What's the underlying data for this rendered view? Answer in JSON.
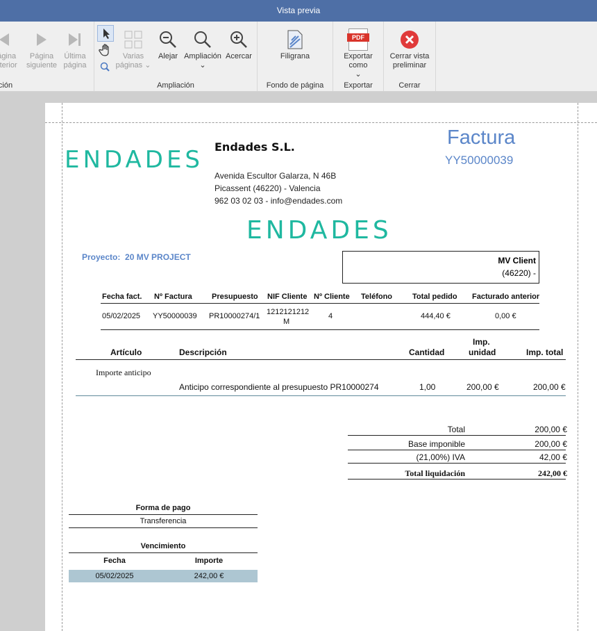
{
  "window": {
    "title": "Vista previa"
  },
  "ribbon": {
    "nav": {
      "prev_label": "Página anterior",
      "next_label": "Página siguiente",
      "last_label": "Última página",
      "group_label": "Navegación"
    },
    "zoom": {
      "multi_label": "Varias páginas",
      "away_label": "Alejar",
      "zoom_label": "Ampliación",
      "closer_label": "Acercar",
      "group_label": "Ampliación"
    },
    "background": {
      "watermark_label": "Filigrana",
      "group_label": "Fondo de página"
    },
    "export": {
      "export_label": "Exportar como",
      "pdf_text": "PDF",
      "group_label": "Exportar"
    },
    "close": {
      "close_label": "Cerrar vista preliminar",
      "group_label": "Cerrar"
    }
  },
  "invoice": {
    "logo_text": "ENDADES",
    "company": "Endades S.L.",
    "address1": "Avenida Escultor Galarza, N 46B",
    "address2": "Picassent (46220) - Valencia",
    "address3": "962 03 02 03 - info@endades.com",
    "doc_title": "Factura",
    "doc_number": "YY50000039",
    "project_label": "Proyecto:",
    "project_value": "20 MV PROJECT",
    "client_name": "MV Client",
    "client_address": "(46220) -",
    "header_table": {
      "columns": [
        "Fecha fact.",
        "Nº Factura",
        "Presupuesto",
        "NIF Cliente",
        "Nº Cliente",
        "Teléfono",
        "Total pedido",
        "Facturado anterior"
      ],
      "row": [
        "05/02/2025",
        "YY50000039",
        "PR10000274/1",
        "1212121212",
        "M",
        "4",
        "",
        "444,40 €",
        "0,00 €"
      ]
    },
    "lines_table": {
      "columns": [
        "Artículo",
        "Descripción",
        "Cantidad",
        "Imp.",
        "unidad",
        "Imp. total"
      ],
      "article": "Importe anticipo",
      "description": "Anticipo correspondiente al presupuesto PR10000274",
      "quantity": "1,00",
      "unit_price": "200,00 €",
      "total": "200,00 €"
    },
    "totals": {
      "total_label": "Total",
      "total_value": "200,00 €",
      "base_label": "Base imponible",
      "base_value": "200,00 €",
      "iva_label": "(21,00%) IVA",
      "iva_value": "42,00 €",
      "liq_label": "Total liquidación",
      "liq_value": "242,00 €"
    },
    "payment": {
      "label": "Forma de pago",
      "value": "Transferencia"
    },
    "due": {
      "label": "Vencimiento",
      "date_col": "Fecha",
      "amount_col": "Importe",
      "date": "05/02/2025",
      "amount": "242,00 €"
    }
  }
}
